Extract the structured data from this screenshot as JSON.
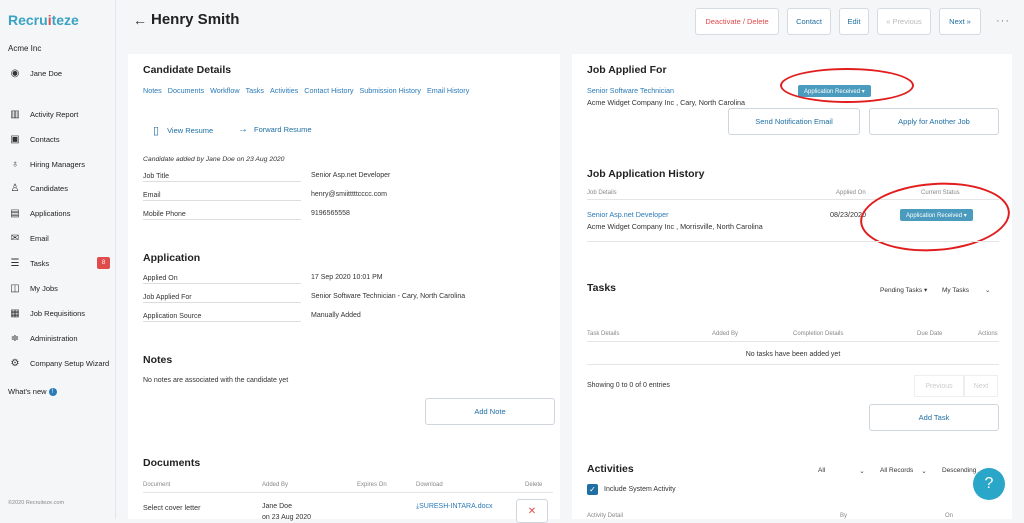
{
  "app": {
    "logo": "Recruiteze",
    "org": "Acme Inc",
    "user": "Jane Doe",
    "whats_new": "What's new",
    "copyright": "©2020 Recruiteze.com"
  },
  "nav": [
    {
      "label": "Activity Report",
      "icon": "bar-chart-icon"
    },
    {
      "label": "Contacts",
      "icon": "contact-card-icon"
    },
    {
      "label": "Hiring Managers",
      "icon": "tie-icon"
    },
    {
      "label": "Candidates",
      "icon": "person-icon"
    },
    {
      "label": "Applications",
      "icon": "application-icon"
    },
    {
      "label": "Email",
      "icon": "email-icon"
    },
    {
      "label": "Tasks",
      "icon": "tasks-icon",
      "badge": "8"
    },
    {
      "label": "My Jobs",
      "icon": "briefcase-icon"
    },
    {
      "label": "Job Requisitions",
      "icon": "requisition-icon"
    },
    {
      "label": "Administration",
      "icon": "sliders-icon"
    },
    {
      "label": "Company Setup Wizard",
      "icon": "gear-icon"
    }
  ],
  "header": {
    "back": "←",
    "name": "Henry Smith",
    "deactivate": "Deactivate / Delete",
    "contact": "Contact",
    "edit": "Edit",
    "previous": "« Previous",
    "next": "Next »",
    "more": "···"
  },
  "candidate": {
    "title": "Candidate Details",
    "tabs": [
      "Notes",
      "Documents",
      "Workflow",
      "Tasks",
      "Activities",
      "Contact History",
      "Submission History",
      "Email History"
    ],
    "view_resume": "View Resume",
    "forward_resume": "Forward Resume",
    "added_note": "Candidate added by Jane Doe on 23 Aug 2020",
    "fields": [
      {
        "label": "Job Title",
        "value": "Senior Asp.net Developer",
        "link": false
      },
      {
        "label": "Email",
        "value": "henry@smiitttttcccc.com",
        "link": true
      },
      {
        "label": "Mobile Phone",
        "value": "9196565558",
        "link": true
      }
    ]
  },
  "application": {
    "title": "Application",
    "fields": [
      {
        "label": "Applied On",
        "value": "17 Sep 2020 10:01 PM"
      },
      {
        "label": "Job Applied For",
        "value": "Senior Software Technician - Cary, North Carolina"
      },
      {
        "label": "Application Source",
        "value": "Manually Added"
      }
    ]
  },
  "notes": {
    "title": "Notes",
    "empty": "No notes are associated with the candidate yet",
    "add": "Add Note"
  },
  "documents": {
    "title": "Documents",
    "headers": [
      "Document",
      "Added By",
      "Expires On",
      "Download",
      "Delete"
    ],
    "row": {
      "doc": "Select cover letter",
      "added_by": "Jane Doe",
      "added_on": "on 23 Aug 2020",
      "file": "SURESH-INTARA.docx"
    }
  },
  "job_applied": {
    "title": "Job Applied For",
    "job": "Senior Software Technician",
    "company": "Acme Widget Company Inc , Cary, North Carolina",
    "status": "Application Received ▾",
    "send": "Send Notification Email",
    "apply_another": "Apply for Another Job"
  },
  "history": {
    "title": "Job Application History",
    "headers": [
      "Job Details",
      "Applied On",
      "Current Status"
    ],
    "job": "Senior Asp.net Developer",
    "company": "Acme Widget Company Inc , Morrisville, North Carolina",
    "date": "08/23/2020",
    "status": "Application Received ▾"
  },
  "tasks": {
    "title": "Tasks",
    "filter1": "Pending Tasks ▾",
    "filter2": "My Tasks",
    "headers": [
      "Task Details",
      "Added By",
      "Completion Details",
      "Due Date",
      "Actions"
    ],
    "empty": "No tasks have been added yet",
    "showing": "Showing 0 to 0 of 0 entries",
    "previous": "Previous",
    "next": "Next",
    "add": "Add Task"
  },
  "activities": {
    "title": "Activities",
    "f1": "All",
    "f2": "All Records",
    "f3": "Descending",
    "include": "Include System Activity",
    "h1": "Activity Detail",
    "h2": "By",
    "h3": "On"
  },
  "colors": {
    "accent": "#2a7ab8",
    "status": "#4a9bbd",
    "danger": "#e04b4b"
  }
}
